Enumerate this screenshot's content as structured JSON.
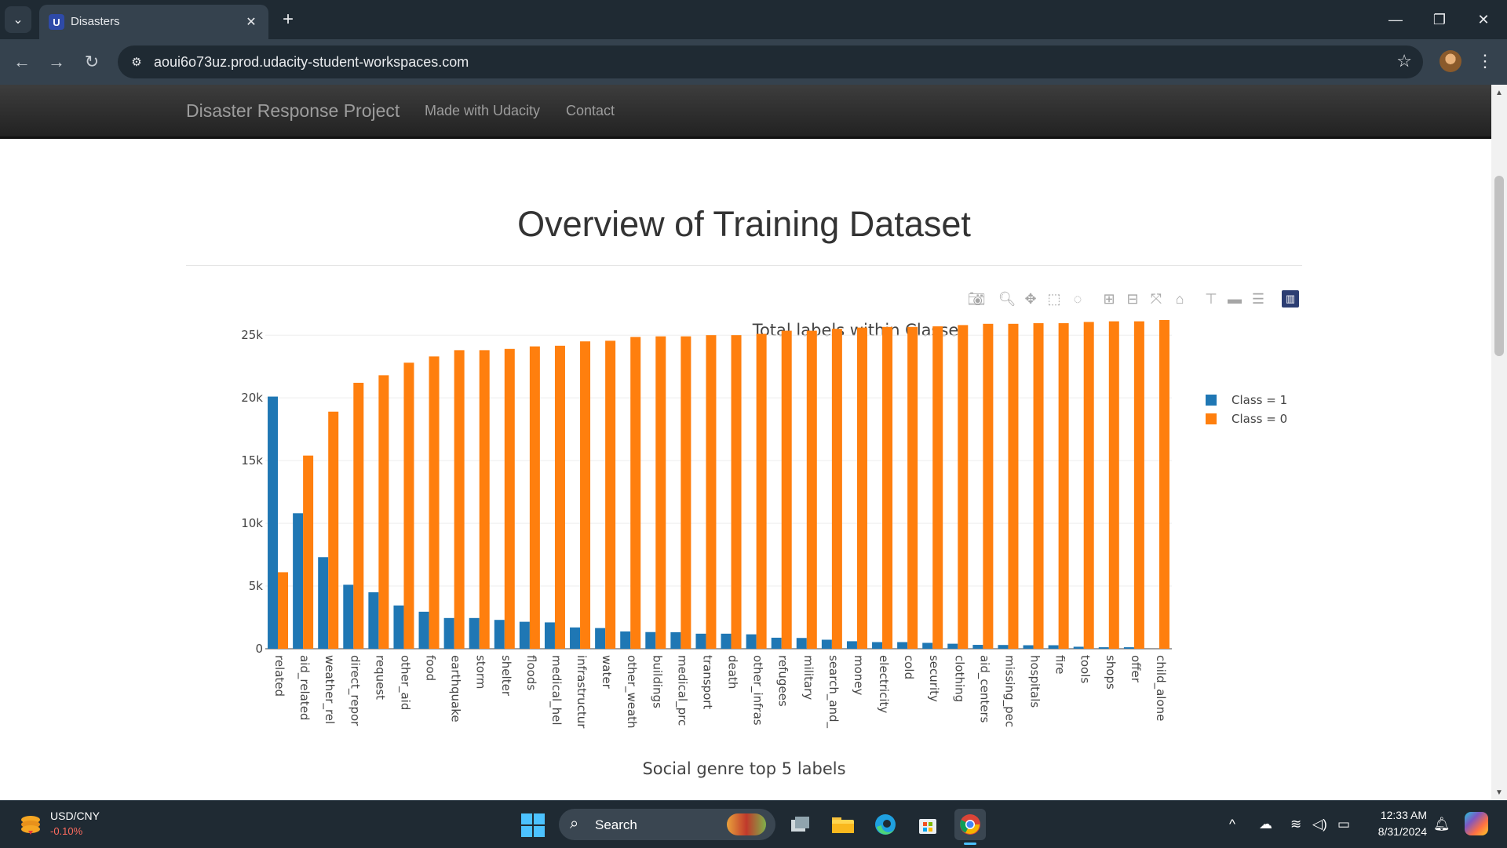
{
  "browser": {
    "tab_title": "Disasters",
    "url": "aoui6o73uz.prod.udacity-student-workspaces.com",
    "window_controls": [
      "minimize-icon",
      "restore-icon",
      "close-icon"
    ]
  },
  "navbar": {
    "brand": "Disaster Response Project",
    "links": [
      "Made with Udacity",
      "Contact"
    ]
  },
  "page": {
    "title": "Overview of Training Dataset",
    "next_chart_title": "Social genre top 5 labels"
  },
  "modebar": {
    "icons": [
      "camera-icon",
      "zoom-icon",
      "pan-icon",
      "box-select-icon",
      "lasso-icon",
      "zoom-in-icon",
      "zoom-out-icon",
      "autoscale-icon",
      "reset-axes-icon",
      "spike-lines-icon",
      "hover-closest-icon",
      "hover-compare-icon",
      "plotly-logo-icon"
    ]
  },
  "chart_data": {
    "type": "bar",
    "title": "Total labels within Classes",
    "xlabel": "",
    "ylabel": "",
    "ylim": [
      0,
      26200
    ],
    "yticks": [
      0,
      5000,
      10000,
      15000,
      20000,
      25000
    ],
    "ytick_labels": [
      "0",
      "5k",
      "10k",
      "15k",
      "20k",
      "25k"
    ],
    "grid": true,
    "legend": "top-right",
    "categories": [
      "related",
      "aid_related",
      "weather_rel",
      "direct_repor",
      "request",
      "other_aid",
      "food",
      "earthquake",
      "storm",
      "shelter",
      "floods",
      "medical_hel",
      "infrastructur",
      "water",
      "other_weath",
      "buildings",
      "medical_prc",
      "transport",
      "death",
      "other_infras",
      "refugees",
      "military",
      "search_and_",
      "money",
      "electricity",
      "cold",
      "security",
      "clothing",
      "aid_centers",
      "missing_pec",
      "hospitals",
      "fire",
      "tools",
      "shops",
      "offer",
      "child_alone"
    ],
    "series": [
      {
        "name": "Class = 1",
        "color": "#1f77b4",
        "values": [
          20100,
          10800,
          7300,
          5100,
          4500,
          3450,
          2950,
          2450,
          2450,
          2300,
          2150,
          2100,
          1700,
          1650,
          1380,
          1330,
          1320,
          1200,
          1200,
          1150,
          880,
          860,
          720,
          600,
          530,
          530,
          470,
          400,
          310,
          300,
          280,
          280,
          160,
          120,
          120,
          0
        ]
      },
      {
        "name": "Class = 0",
        "color": "#ff7f0e",
        "values": [
          6100,
          15400,
          18900,
          21200,
          21800,
          22800,
          23300,
          23800,
          23800,
          23900,
          24100,
          24150,
          24500,
          24550,
          24850,
          24900,
          24900,
          25000,
          25000,
          25100,
          25350,
          25350,
          25500,
          25600,
          25650,
          25650,
          25700,
          25800,
          25900,
          25900,
          25950,
          25950,
          26050,
          26100,
          26100,
          26200
        ]
      }
    ]
  },
  "taskbar": {
    "widget_label": "USD/CNY",
    "widget_value": "-0.10%",
    "search_placeholder": "Search",
    "time": "12:33 AM",
    "date": "8/31/2024"
  }
}
